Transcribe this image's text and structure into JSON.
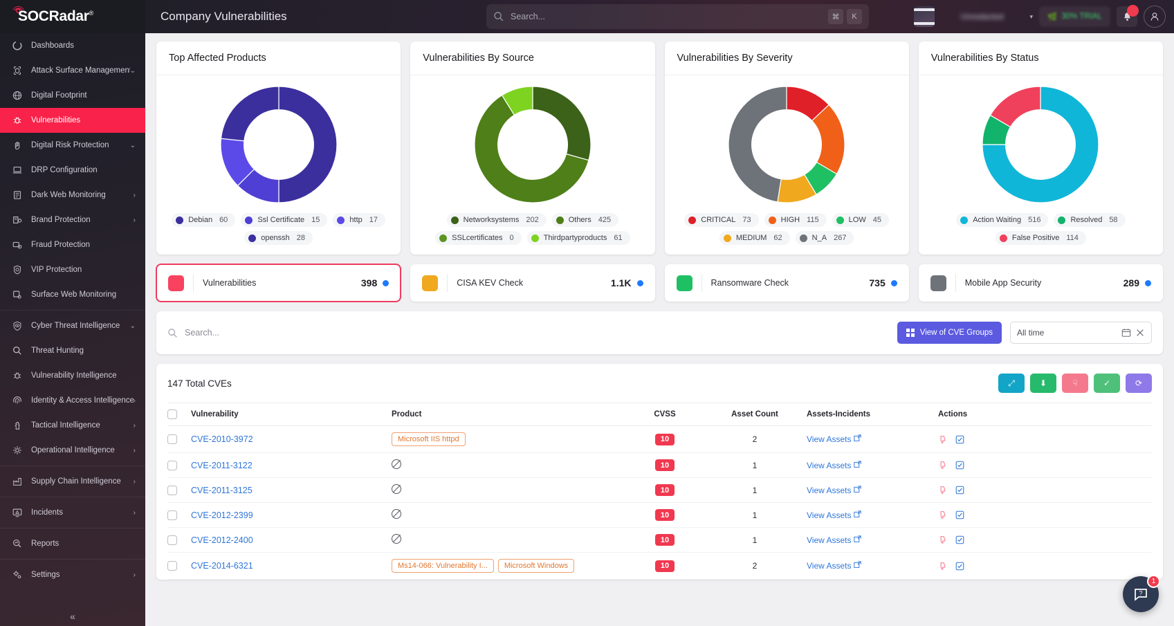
{
  "brand": {
    "name": "SOCRadar",
    "registered": "®"
  },
  "header": {
    "page_title": "Company Vulnerabilities",
    "search_placeholder": "Search...",
    "kbd_cmd": "⌘",
    "kbd_k": "K",
    "org_name": "Unredacted",
    "trial_label": "30% TRIAL",
    "notification_count": "",
    "chat_badge": "1"
  },
  "sidebar": {
    "items": [
      {
        "label": "Dashboards",
        "icon": "dashboard-icon",
        "chevron": "",
        "active": false
      },
      {
        "label": "Attack Surface Management",
        "icon": "shield-scan-icon",
        "chevron": "⌄",
        "active": false
      },
      {
        "label": "Digital Footprint",
        "icon": "globe-icon",
        "chevron": "",
        "active": false
      },
      {
        "label": "Vulnerabilities",
        "icon": "bug-icon",
        "chevron": "",
        "active": true
      },
      {
        "label": "Digital Risk Protection",
        "icon": "hand-icon",
        "chevron": "⌄",
        "active": false
      },
      {
        "label": "DRP Configuration",
        "icon": "laptop-icon",
        "chevron": "",
        "active": false
      },
      {
        "label": "Dark Web Monitoring",
        "icon": "darkweb-icon",
        "chevron": "›",
        "active": false
      },
      {
        "label": "Brand Protection",
        "icon": "brand-icon",
        "chevron": "›",
        "active": false
      },
      {
        "label": "Fraud Protection",
        "icon": "fraud-icon",
        "chevron": "",
        "active": false
      },
      {
        "label": "VIP Protection",
        "icon": "vip-icon",
        "chevron": "",
        "active": false
      },
      {
        "label": "Surface Web Monitoring",
        "icon": "surfaceweb-icon",
        "chevron": "",
        "active": false
      },
      {
        "label": "Cyber Threat Intelligence",
        "icon": "eye-shield-icon",
        "chevron": "⌄",
        "active": false
      },
      {
        "label": "Threat Hunting",
        "icon": "search-icon",
        "chevron": "",
        "active": false
      },
      {
        "label": "Vulnerability Intelligence",
        "icon": "bug-icon",
        "chevron": "",
        "active": false
      },
      {
        "label": "Identity & Access Intelligence",
        "icon": "fingerprint-icon",
        "chevron": "›",
        "active": false
      },
      {
        "label": "Tactical Intelligence",
        "icon": "chess-icon",
        "chevron": "›",
        "active": false
      },
      {
        "label": "Operational Intelligence",
        "icon": "gear-node-icon",
        "chevron": "›",
        "active": false
      },
      {
        "label": "Supply Chain Intelligence",
        "icon": "factory-icon",
        "chevron": "›",
        "active": false
      },
      {
        "label": "Incidents",
        "icon": "monitor-alert-icon",
        "chevron": "›",
        "active": false
      },
      {
        "label": "Reports",
        "icon": "report-icon",
        "chevron": "",
        "active": false
      },
      {
        "label": "Settings",
        "icon": "gears-icon",
        "chevron": "›",
        "active": false
      }
    ],
    "collapse_icon": "«"
  },
  "chart_data": [
    {
      "type": "pie",
      "title": "Top Affected Products",
      "categories": [
        "Debian",
        "Ssl Certificate",
        "http",
        "openssh"
      ],
      "values": [
        60,
        15,
        17,
        28
      ],
      "colors": [
        "#3b2f9e",
        "#4f3fd4",
        "#5b4ae8",
        "#3b2f9e"
      ],
      "legend_position": "bottom",
      "donut": true
    },
    {
      "type": "pie",
      "title": "Vulnerabilities By Source",
      "categories": [
        "Networksystems",
        "Others",
        "SSLcertificates",
        "Thirdpartyproducts"
      ],
      "values": [
        202,
        425,
        0,
        61
      ],
      "colors": [
        "#3c6118",
        "#4f7f18",
        "#5c9422",
        "#7ed321"
      ],
      "legend_position": "bottom",
      "donut": true
    },
    {
      "type": "pie",
      "title": "Vulnerabilities By Severity",
      "categories": [
        "CRITICAL",
        "HIGH",
        "LOW",
        "MEDIUM",
        "N_A"
      ],
      "values": [
        73,
        115,
        45,
        62,
        267
      ],
      "colors": [
        "#e02028",
        "#f06018",
        "#1fc063",
        "#f0a81e",
        "#6e7279"
      ],
      "legend_position": "bottom",
      "donut": true
    },
    {
      "type": "pie",
      "title": "Vulnerabilities By Status",
      "categories": [
        "Action Waiting",
        "Resolved",
        "False Positive"
      ],
      "values": [
        516,
        58,
        114
      ],
      "colors": [
        "#10b6d8",
        "#12b36b",
        "#f0415c"
      ],
      "legend_position": "bottom",
      "donut": true
    }
  ],
  "metrics": [
    {
      "label": "Vulnerabilities",
      "value": "398",
      "color": "#f9425f",
      "selected": true
    },
    {
      "label": "CISA KEV Check",
      "value": "1.1K",
      "color": "#f0a81e",
      "selected": false
    },
    {
      "label": "Ransomware Check",
      "value": "735",
      "color": "#1fc063",
      "selected": false
    },
    {
      "label": "Mobile App Security",
      "value": "289",
      "color": "#6e7279",
      "selected": false
    }
  ],
  "filters": {
    "search_placeholder": "Search...",
    "cve_groups_label": "View of CVE Groups",
    "date_label": "All time"
  },
  "table": {
    "total_label": "147 Total CVEs",
    "action_buttons": [
      {
        "name": "scan-button",
        "glyph": "⤢",
        "color": "#12a5c8"
      },
      {
        "name": "download-button",
        "glyph": "⬇",
        "color": "#27ba6c"
      },
      {
        "name": "false-positive-button",
        "glyph": "☟",
        "color": "#f4798c"
      },
      {
        "name": "resolve-button",
        "glyph": "✓",
        "color": "#4ec07a"
      },
      {
        "name": "refresh-button",
        "glyph": "⟳",
        "color": "#8e79e8"
      }
    ],
    "columns": [
      "Vulnerability",
      "Product",
      "CVSS",
      "Asset Count",
      "Assets-Incidents",
      "Actions"
    ],
    "view_assets_label": "View Assets",
    "rows": [
      {
        "cve": "CVE-2010-3972",
        "products": [
          "Microsoft IIS httpd"
        ],
        "cvss": "10",
        "assets": "2"
      },
      {
        "cve": "CVE-2011-3122",
        "products": [],
        "cvss": "10",
        "assets": "1"
      },
      {
        "cve": "CVE-2011-3125",
        "products": [],
        "cvss": "10",
        "assets": "1"
      },
      {
        "cve": "CVE-2012-2399",
        "products": [],
        "cvss": "10",
        "assets": "1"
      },
      {
        "cve": "CVE-2012-2400",
        "products": [],
        "cvss": "10",
        "assets": "1"
      },
      {
        "cve": "CVE-2014-6321",
        "products": [
          "Ms14-066: Vulnerability I...",
          "Microsoft Windows"
        ],
        "cvss": "10",
        "assets": "2"
      }
    ]
  }
}
